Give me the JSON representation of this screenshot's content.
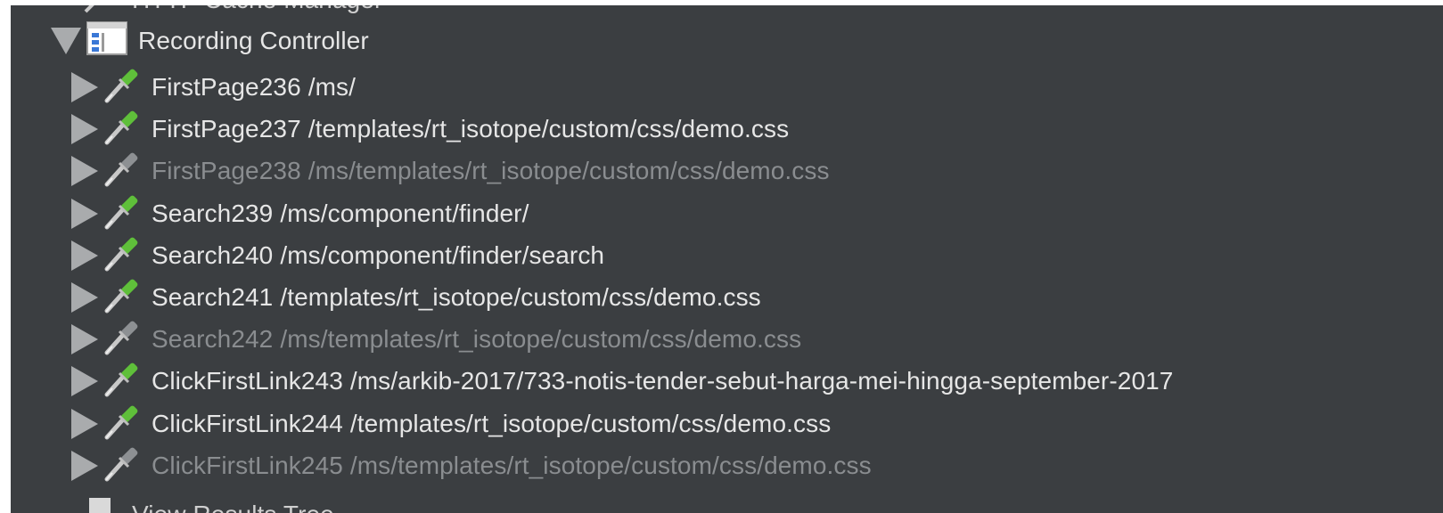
{
  "tree": {
    "top_partial_label": "HTTP Cache Manager",
    "controller": {
      "label": "Recording Controller",
      "icon": "recording-controller-icon"
    },
    "samplers": [
      {
        "name": "FirstPage236",
        "path": "/ms/",
        "enabled": true
      },
      {
        "name": "FirstPage237",
        "path": "/templates/rt_isotope/custom/css/demo.css",
        "enabled": true
      },
      {
        "name": "FirstPage238",
        "path": "/ms/templates/rt_isotope/custom/css/demo.css",
        "enabled": false
      },
      {
        "name": "Search239",
        "path": "/ms/component/finder/",
        "enabled": true
      },
      {
        "name": "Search240",
        "path": "/ms/component/finder/search",
        "enabled": true
      },
      {
        "name": "Search241",
        "path": "/templates/rt_isotope/custom/css/demo.css",
        "enabled": true
      },
      {
        "name": "Search242",
        "path": "/ms/templates/rt_isotope/custom/css/demo.css",
        "enabled": false
      },
      {
        "name": "ClickFirstLink243",
        "path": "/ms/arkib-2017/733-notis-tender-sebut-harga-mei-hingga-september-2017",
        "enabled": true
      },
      {
        "name": "ClickFirstLink244",
        "path": "/templates/rt_isotope/custom/css/demo.css",
        "enabled": true
      },
      {
        "name": "ClickFirstLink245",
        "path": "/ms/templates/rt_isotope/custom/css/demo.css",
        "enabled": false
      }
    ],
    "bottom_partial_label": "View Results Tree"
  },
  "colors": {
    "background": "#3b3e41",
    "text": "#e6e6e6",
    "disabled_text": "#8a8d90",
    "pipette_green": "#5fbf3a",
    "pipette_gray": "#8d9093"
  }
}
